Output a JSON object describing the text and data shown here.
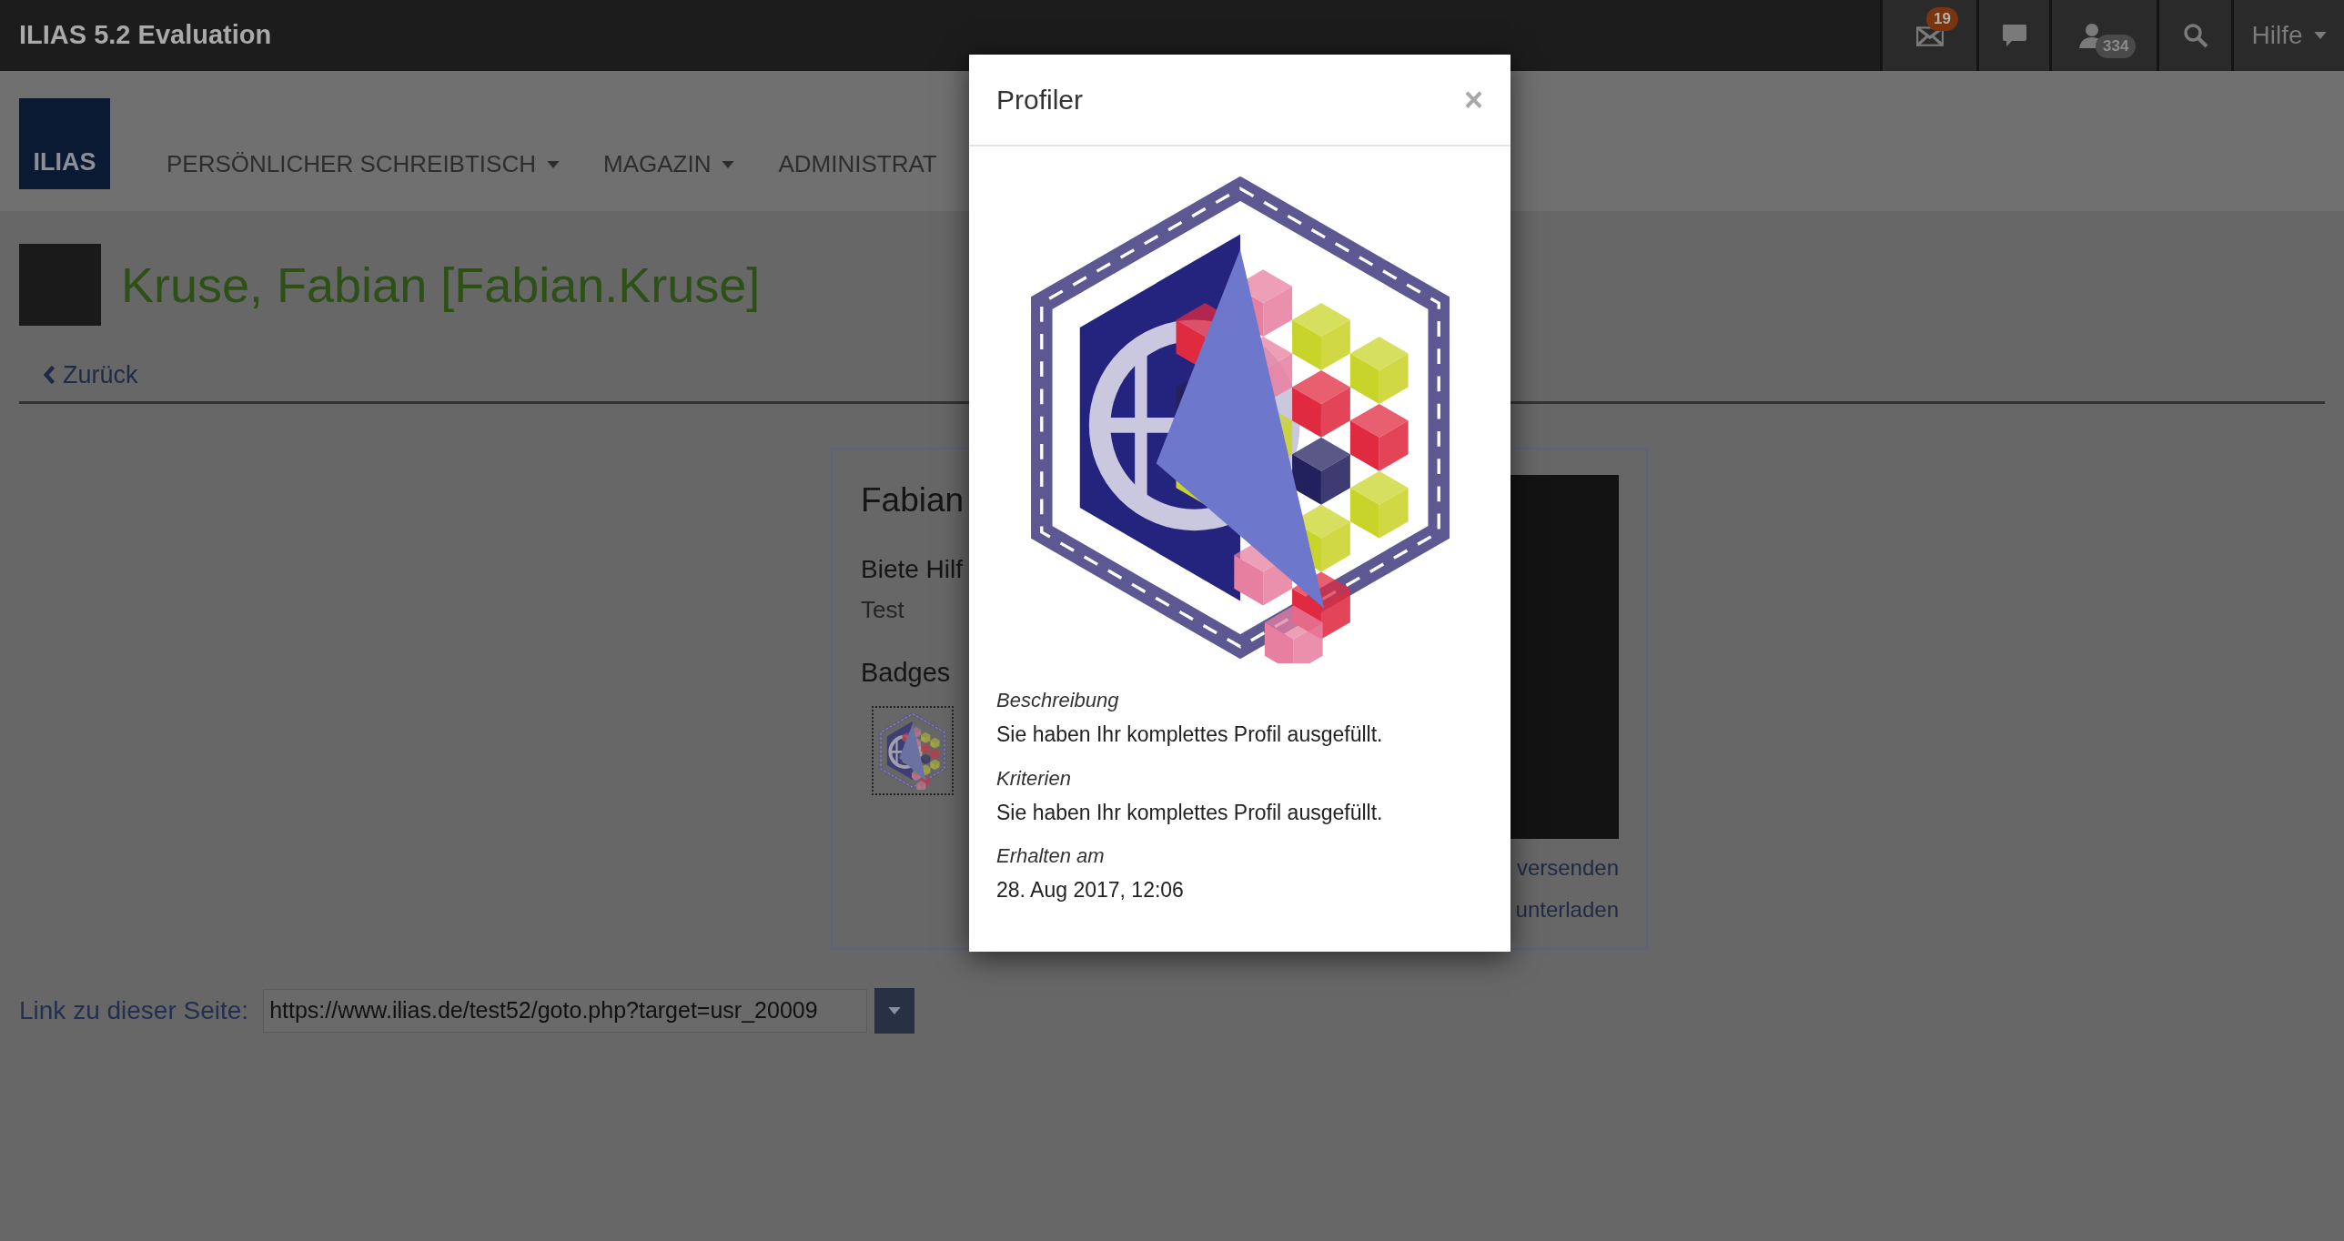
{
  "topbar": {
    "title": "ILIAS 5.2 Evaluation",
    "mail_count": "19",
    "contacts_count": "334",
    "help_menu": "Hilfe"
  },
  "nav": {
    "logo": "ILIAS",
    "items": [
      {
        "label": "PERSÖNLICHER SCHREIBTISCH",
        "dropdown": true
      },
      {
        "label": "MAGAZIN",
        "dropdown": true
      },
      {
        "label": "ADMINISTRAT",
        "dropdown": false
      }
    ]
  },
  "profile_header": {
    "title": "Kruse, Fabian [Fabian.Kruse]",
    "back_link": "Zurück"
  },
  "card": {
    "name": "Fabian",
    "section_heading": "Biete Hilf",
    "section_text": "Test",
    "badges_heading": "Badges",
    "links": [
      "versenden",
      "unterladen"
    ]
  },
  "link_row": {
    "label": "Link zu dieser Seite:",
    "url": "https://www.ilias.de/test52/goto.php?target=usr_20009"
  },
  "modal": {
    "title": "Profiler",
    "close": "×",
    "fields": [
      {
        "label": "Beschreibung",
        "value": "Sie haben Ihr komplettes Profil ausgefüllt."
      },
      {
        "label": "Kriterien",
        "value": "Sie haben Ihr komplettes Profil ausgefüllt."
      },
      {
        "label": "Erhalten am",
        "value": "28. Aug 2017, 12:06"
      }
    ]
  }
}
